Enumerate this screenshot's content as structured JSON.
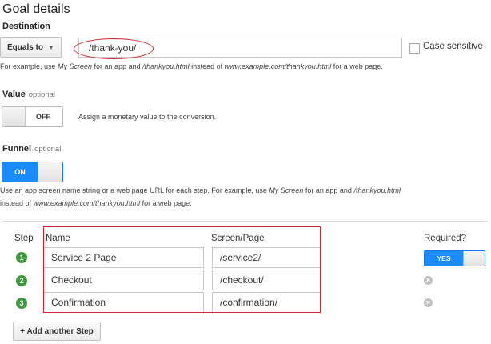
{
  "title": "Goal details",
  "destination": {
    "label": "Destination",
    "match_type": "Equals to",
    "value": "/thank-you/",
    "case_sensitive_label": "Case sensitive",
    "case_sensitive_checked": false,
    "help_prefix": "For example, use ",
    "help_app_example": "My Screen",
    "help_mid1": " for an app and ",
    "help_page_example": "/thankyou.html",
    "help_mid2": " instead of ",
    "help_url_example": "www.example.com/thankyou.html",
    "help_suffix": " for a web page."
  },
  "value_section": {
    "label": "Value",
    "optional": "optional",
    "toggle_state": "OFF",
    "description": "Assign a monetary value to the conversion."
  },
  "funnel": {
    "label": "Funnel",
    "optional": "optional",
    "toggle_state": "ON",
    "help_prefix": "Use an app screen name string or a web page URL for each step. For example, use ",
    "help_app_example": "My Screen",
    "help_mid1": " for an app and ",
    "help_page_example": "/thankyou.html",
    "help_line2_prefix": "instead of ",
    "help_url_example": "www.example.com/thankyou.html",
    "help_suffix": " for a web page.",
    "columns": {
      "step": "Step",
      "name": "Name",
      "screen": "Screen/Page",
      "required": "Required?"
    },
    "steps": [
      {
        "num": "1",
        "name": "Service 2 Page",
        "screen": "/service2/",
        "required": "YES"
      },
      {
        "num": "2",
        "name": "Checkout",
        "screen": "/checkout/"
      },
      {
        "num": "3",
        "name": "Confirmation",
        "screen": "/confirmation/"
      }
    ],
    "add_step_label": "+ Add another Step"
  },
  "colors": {
    "accent_blue": "#1a8cff",
    "step_green": "#3c9a3c",
    "annotation_red": "#d0262d"
  }
}
